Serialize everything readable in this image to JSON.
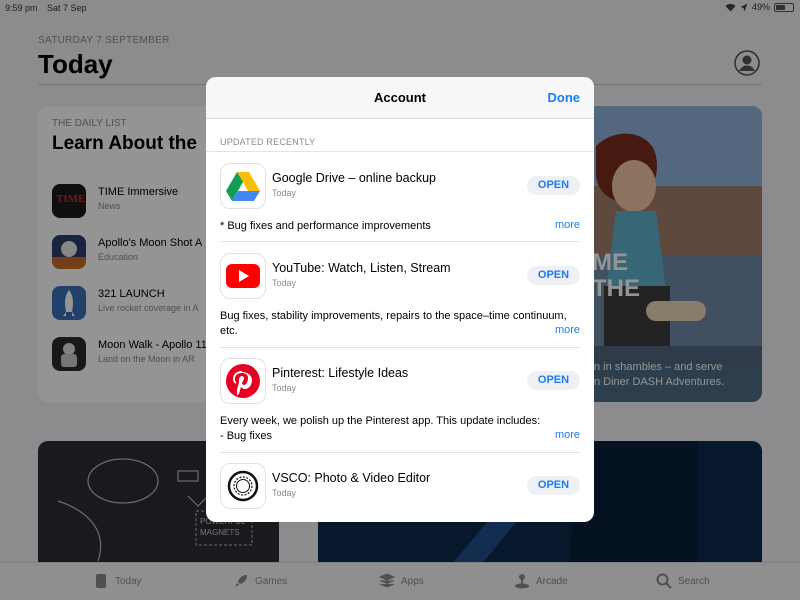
{
  "status_bar": {
    "time": "9:59 pm",
    "date": "Sat 7 Sep",
    "battery": "49%",
    "battery_level": 0.49
  },
  "background": {
    "date": "SATURDAY 7 SEPTEMBER",
    "title": "Today",
    "daily_list": {
      "kicker": "THE DAILY LIST",
      "title": "Learn About the",
      "items": [
        {
          "name": "TIME Immersive",
          "category": "News"
        },
        {
          "name": "Apollo's Moon Shot A",
          "category": "Education"
        },
        {
          "name": "321 LAUNCH",
          "category": "Live rocket coverage in A"
        },
        {
          "name": "Moon Walk - Apollo 11",
          "category": "Land on the Moon in AR"
        }
      ]
    },
    "feature_caption": "n in shambles – and serve\nn Diner DASH Adventures.",
    "feature_art_text": "ME\nTHE",
    "magnets_text": "POWERFUL\nMAGNETS"
  },
  "tabbar": {
    "tabs": [
      {
        "label": "Today",
        "icon": "today-icon"
      },
      {
        "label": "Games",
        "icon": "rocket-icon"
      },
      {
        "label": "Apps",
        "icon": "apps-stack-icon"
      },
      {
        "label": "Arcade",
        "icon": "joystick-icon"
      },
      {
        "label": "Search",
        "icon": "search-icon"
      }
    ]
  },
  "modal": {
    "title": "Account",
    "done_label": "Done",
    "section_header": "UPDATED RECENTLY",
    "updates": [
      {
        "name": "Google Drive – online backup",
        "date": "Today",
        "action": "OPEN",
        "notes": "* Bug fixes and performance improvements",
        "more": "more",
        "icon": "google-drive-icon"
      },
      {
        "name": "YouTube: Watch, Listen, Stream",
        "date": "Today",
        "action": "OPEN",
        "notes": "Bug fixes, stability improvements, repairs to the space–time continuum, etc.",
        "more": "more",
        "icon": "youtube-icon"
      },
      {
        "name": "Pinterest: Lifestyle Ideas",
        "date": "Today",
        "action": "OPEN",
        "notes": "Every week, we polish up the Pinterest app. This update includes:\n- Bug fixes",
        "more": "more",
        "icon": "pinterest-icon"
      },
      {
        "name": "VSCO: Photo & Video Editor",
        "date": "Today",
        "action": "OPEN",
        "notes": "",
        "more": "",
        "icon": "vsco-icon"
      }
    ]
  },
  "colors": {
    "accent": "#1a7cf4",
    "youtube": "#ff0000",
    "pinterest": "#e60023"
  }
}
